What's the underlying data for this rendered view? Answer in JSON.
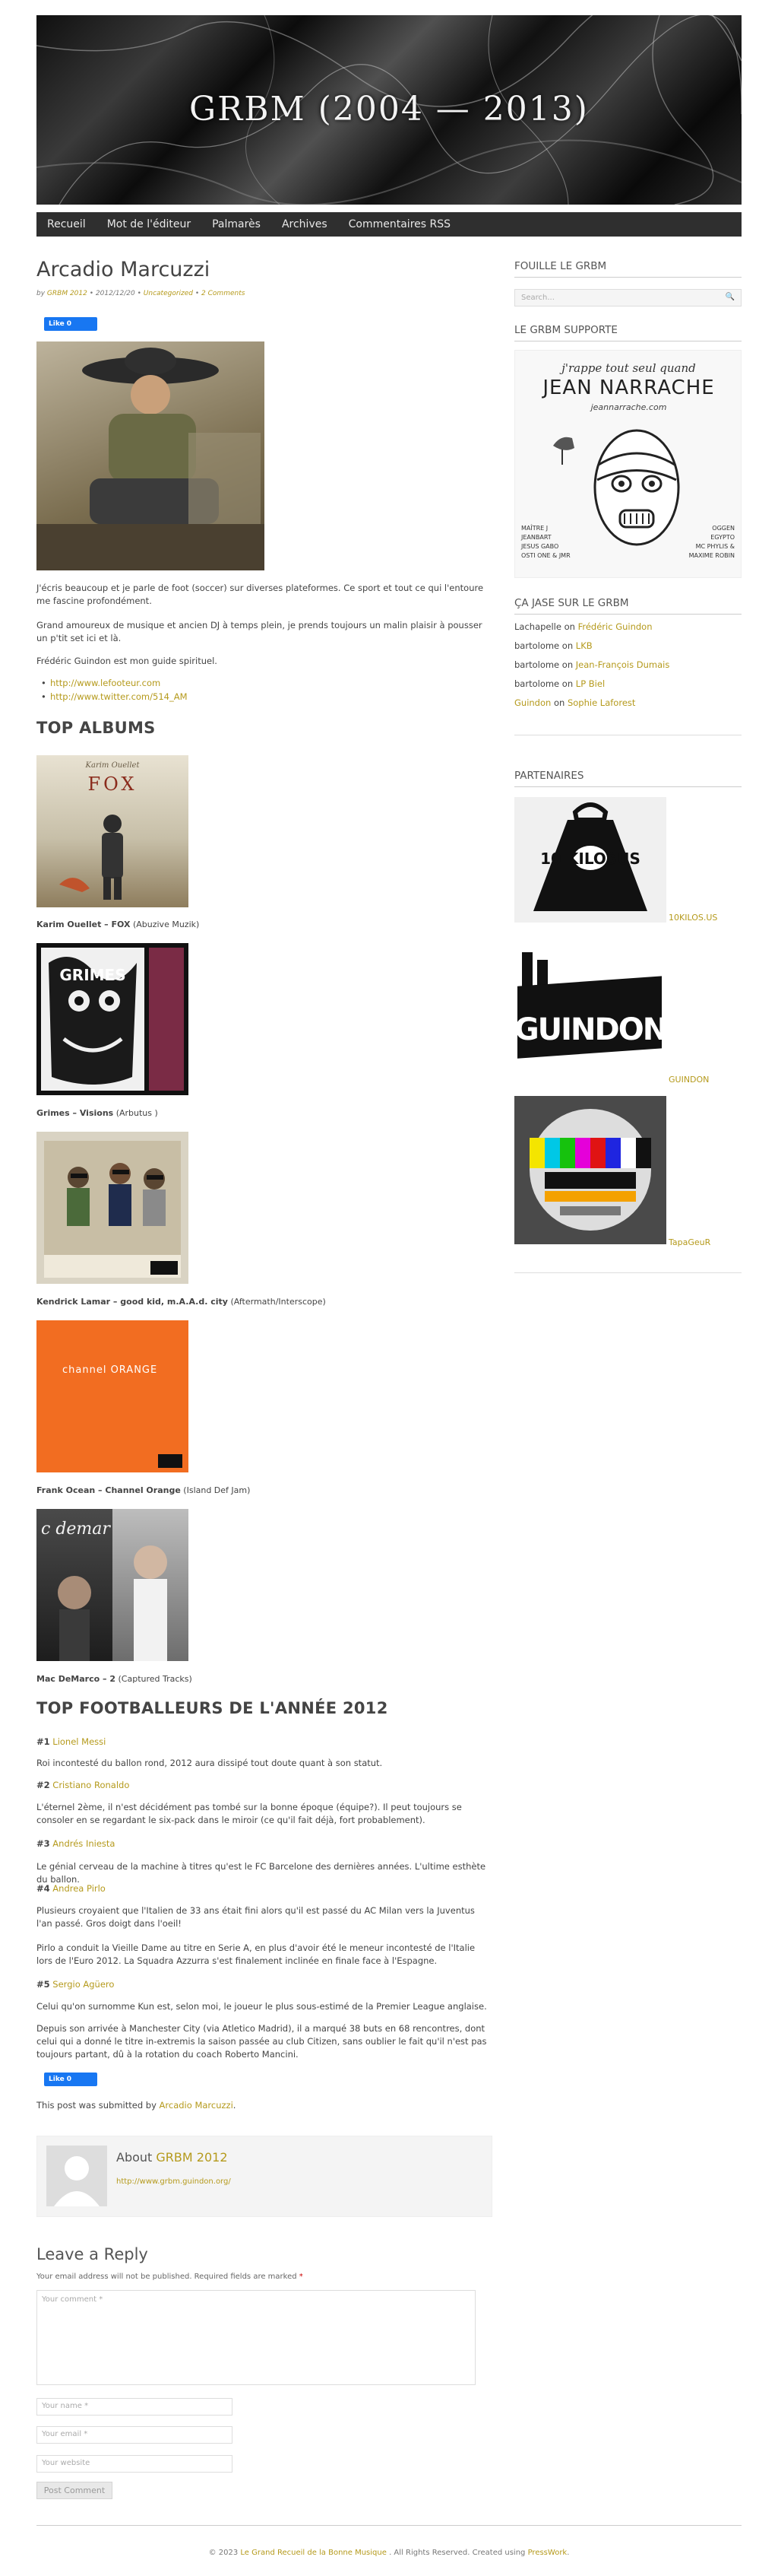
{
  "site": {
    "title": "GRBM (2004 — 2013)"
  },
  "nav": [
    "Recueil",
    "Mot de l'éditeur",
    "Palmarès",
    "Archives",
    "Commentaires RSS"
  ],
  "post": {
    "title": "Arcadio Marcuzzi",
    "meta_by": "by",
    "meta_author": "GRBM 2012",
    "meta_date": " • 2012/12/20 • ",
    "meta_cat": "Uncategorized",
    "meta_sep": " • ",
    "meta_comments": "2 Comments",
    "like_label": "Like 0",
    "intro": [
      "J'écris beaucoup et je parle de foot (soccer) sur diverses plateformes. Ce sport et tout ce qui l'entoure me fascine profondément.",
      "Grand amoureux de musique et ancien DJ à temps plein, je prends toujours un malin plaisir à pousser un p'tit set ici et là.",
      "Frédéric Guindon est mon guide spirituel."
    ],
    "links": [
      "http://www.lefooteur.com",
      "http://www.twitter.com/514_AM"
    ],
    "albums_heading": "TOP ALBUMS",
    "albums": [
      {
        "bold": "Karim Ouellet – FOX",
        "label": "(Abuzive Muzik)",
        "cover_text": "FOX"
      },
      {
        "bold": "Grimes – Visions",
        "label": "(Arbutus )",
        "cover_text": "GRIMES"
      },
      {
        "bold": "Kendrick Lamar – good kid, m.A.A.d. city",
        "label": "(Aftermath/Interscope)",
        "cover_text": ""
      },
      {
        "bold": "Frank Ocean – Channel Orange",
        "label": "(Island Def Jam)",
        "cover_text": "channel ORANGE"
      },
      {
        "bold": "Mac DeMarco – 2",
        "label": "(Captured Tracks)",
        "cover_text": "c demar"
      }
    ],
    "players_heading": "TOP FOOTBALLEURS DE L'ANNÉE 2012",
    "players": [
      {
        "rank": "#1",
        "name": "Lionel Messi",
        "text": [
          "Roi incontesté du ballon rond, 2012 aura dissipé tout doute quant à son statut."
        ]
      },
      {
        "rank": "#2",
        "name": "Cristiano Ronaldo",
        "text": [
          "L'éternel 2ème, il n'est décidément pas tombé sur la bonne époque (équipe?). Il peut toujours se consoler en se regardant le six-pack dans le miroir (ce qu'il fait déjà, fort probablement)."
        ]
      },
      {
        "rank": "#3",
        "name": "Andrés Iniesta",
        "text": [
          "Le génial cerveau de la machine à titres qu'est le FC Barcelone des dernières années. L'ultime esthète du ballon."
        ]
      },
      {
        "rank": "#4",
        "name": "Andrea Pirlo",
        "text": [
          "Plusieurs croyaient que l'Italien de 33 ans était fini alors qu'il est passé du AC Milan vers la Juventus l'an passé. Gros doigt dans l'oeil!",
          "Pirlo a conduit la Vieille Dame au titre en Serie A, en plus d'avoir été le meneur incontesté de l'Italie lors de l'Euro 2012. La Squadra Azzurra s'est finalement inclinée en finale face à l'Espagne."
        ]
      },
      {
        "rank": "#5",
        "name": "Sergio Agüero",
        "text": [
          "Celui qu'on surnomme Kun est, selon moi, le joueur le plus sous-estimé de la Premier League anglaise.",
          "Depuis son arrivée à Manchester City (via Atletico Madrid), il a marqué 38 buts en 68 rencontres, dont celui qui a donné le titre in-extremis la saison passée au club Citizen, sans oublier le fait qu'il n'est pas toujours partant, dû à la rotation du coach Roberto Mancini."
        ]
      }
    ],
    "submitted_prefix": "This post was submitted by ",
    "submitted_author": "Arcadio Marcuzzi",
    "submitted_suffix": "."
  },
  "author_box": {
    "about": "About ",
    "name": "GRBM 2012",
    "url": "http://www.grbm.guindon.org/"
  },
  "reply": {
    "heading": "Leave a Reply",
    "note": "Your email address will not be published. Required fields are marked ",
    "required_mark": "*",
    "comment_placeholder": "Your comment *",
    "name_placeholder": "Your name *",
    "email_placeholder": "Your email *",
    "website_placeholder": "Your website",
    "submit": "Post Comment"
  },
  "sidebar": {
    "search_heading": "FOUILLE LE GRBM",
    "search_placeholder": "Search...",
    "support_heading": "LE GRBM SUPPORTE",
    "poster": {
      "line1": "j'rappe tout seul quand",
      "line2": "JEAN NARRACHE",
      "site": "jeannarrache.com",
      "left": [
        "MAÎTRE J",
        "JEANBART",
        "JESUS GABO",
        "OSTI ONE & JMR"
      ],
      "right": [
        "OGGEN",
        "EGYPTO",
        "MC PHYLIS &",
        "MAXIME ROBIN"
      ]
    },
    "comments_heading": "ÇA JASE SUR LE GRBM",
    "comments": [
      {
        "who": "Lachapelle",
        "on": " on ",
        "post": "Frédéric Guindon",
        "who_link": false
      },
      {
        "who": "bartolome",
        "on": " on ",
        "post": "LKB",
        "who_link": false
      },
      {
        "who": "bartolome",
        "on": " on ",
        "post": "Jean-François Dumais",
        "who_link": false
      },
      {
        "who": "bartolome",
        "on": " on ",
        "post": "LP Biel",
        "who_link": false
      },
      {
        "who": "Guindon",
        "on": " on ",
        "post": "Sophie Laforest",
        "who_link": true
      }
    ],
    "partners_heading": "PARTENAIRES",
    "partners": [
      {
        "name": "10KILOS.US",
        "logo_text": "10 KILOSUS"
      },
      {
        "name": "GUINDON",
        "logo_text": "GUINDON"
      },
      {
        "name": "TapaGeuR",
        "logo_text": ""
      }
    ]
  },
  "footer": {
    "prefix": "© 2023 ",
    "site": "Le Grand Recueil de la Bonne Musique",
    "mid": " . All Rights Reserved. Created using ",
    "credit": "PressWork",
    "suffix": "."
  },
  "colors": {
    "link": "#b59a1c",
    "nav_bg": "#2f2f2f",
    "like": "#1877f2",
    "orange": "#f26d21"
  }
}
